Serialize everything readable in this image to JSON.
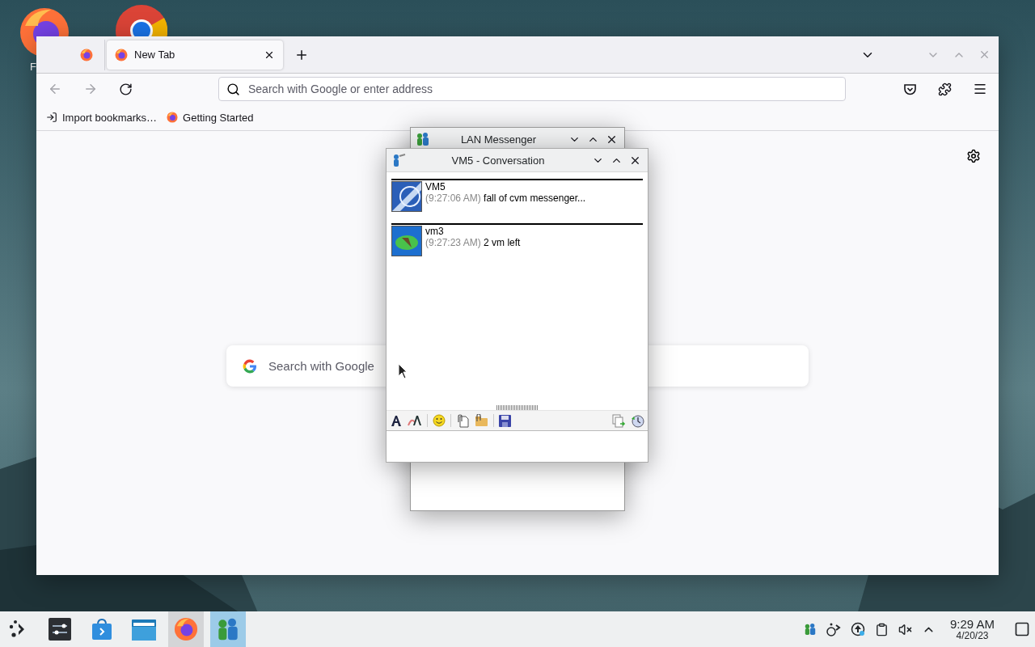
{
  "desktop": {
    "icons": [
      {
        "kind": "firefox",
        "label": "F"
      },
      {
        "kind": "chrome"
      }
    ]
  },
  "browser": {
    "tabs": [
      {
        "kind": "pinned",
        "selected": false
      },
      {
        "kind": "normal",
        "label": "New Tab",
        "selected": true
      }
    ],
    "nav_buttons": [
      {
        "kind": "back",
        "disabled": true
      },
      {
        "kind": "forward",
        "disabled": true
      },
      {
        "kind": "reload",
        "disabled": false
      }
    ],
    "address": {
      "placeholder": "Search with Google or enter address"
    },
    "bookmarks": [
      {
        "kind": "import",
        "label": "Import bookmarks…"
      },
      {
        "kind": "firefox",
        "label": "Getting Started"
      }
    ],
    "page_search": {
      "placeholder": "Search with Google"
    }
  },
  "messenger": {
    "title": "LAN Messenger"
  },
  "conversation": {
    "title": "VM5 - Conversation",
    "messages": [
      {
        "sender": "VM5",
        "time": "(9:27:06 AM)",
        "text": "fall of cvm messenger..."
      },
      {
        "sender": "vm3",
        "time": "(9:27:23 AM)",
        "text": "2 vm left"
      }
    ]
  },
  "taskbar": {
    "apps": [
      {
        "kind": "launcher",
        "open": false,
        "selected": false
      },
      {
        "kind": "settings",
        "open": false,
        "selected": false
      },
      {
        "kind": "store",
        "open": false,
        "selected": false
      },
      {
        "kind": "files",
        "open": false,
        "selected": false
      },
      {
        "kind": "firefox",
        "open": true,
        "selected": false
      },
      {
        "kind": "messenger",
        "open": true,
        "selected": true
      }
    ],
    "tray": [
      {
        "kind": "messenger"
      },
      {
        "kind": "network"
      },
      {
        "kind": "updates"
      },
      {
        "kind": "clipboard"
      },
      {
        "kind": "muted"
      },
      {
        "kind": "expand"
      }
    ],
    "time": "9:29 AM",
    "date": "4/20/23"
  }
}
